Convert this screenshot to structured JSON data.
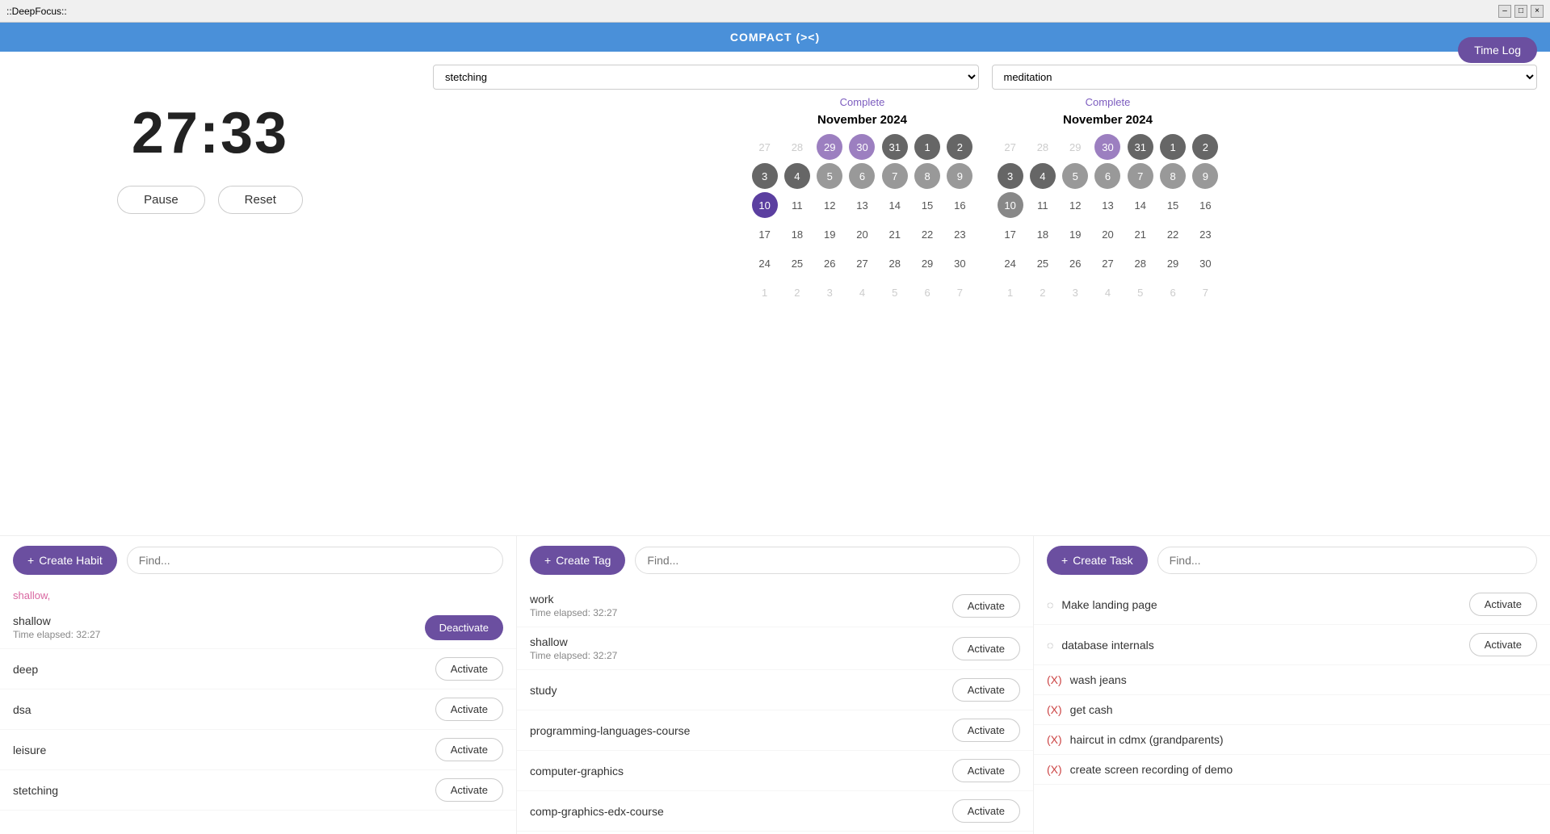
{
  "titleBar": {
    "appName": "::DeepFocus::",
    "controls": [
      "–",
      "□",
      "×"
    ]
  },
  "topBar": {
    "title": "COMPACT (><)"
  },
  "timeLog": {
    "label": "Time Log"
  },
  "timer": {
    "display": "27:33",
    "pauseLabel": "Pause",
    "resetLabel": "Reset"
  },
  "habits": {
    "dropdown1": "stetching",
    "dropdown2": "meditation",
    "completeLabel1": "Complete",
    "completeLabel2": "Complete"
  },
  "calendar1": {
    "title": "November 2024",
    "weeks": [
      [
        "27",
        "28",
        "29",
        "30",
        "31",
        "1",
        "2"
      ],
      [
        "3",
        "4",
        "5",
        "6",
        "7",
        "8",
        "9"
      ],
      [
        "10",
        "11",
        "12",
        "13",
        "14",
        "15",
        "16"
      ],
      [
        "17",
        "18",
        "19",
        "20",
        "21",
        "22",
        "23"
      ],
      [
        "24",
        "25",
        "26",
        "27",
        "28",
        "29",
        "30"
      ],
      [
        "1",
        "2",
        "3",
        "4",
        "5",
        "6",
        "7"
      ]
    ],
    "dayStyles": {
      "27_0": "outer",
      "28_0": "outer",
      "29_0": "filled",
      "30_0": "filled",
      "31_0": "dark",
      "1_0": "dark",
      "2_0": "dark",
      "3_1": "dark",
      "4_1": "dark",
      "5_1": "medium",
      "6_1": "medium",
      "7_1": "medium",
      "8_1": "medium",
      "9_1": "medium",
      "10_2": "today",
      "11_2": "",
      "12_2": "",
      "13_2": "",
      "14_2": "",
      "15_2": "",
      "16_2": "",
      "17_3": "",
      "18_3": "",
      "19_3": "",
      "20_3": "",
      "21_3": "",
      "22_3": "",
      "23_3": "",
      "24_4": "",
      "25_4": "",
      "26_4": "",
      "27_4": "",
      "28_4": "",
      "29_4": "",
      "30_4": "",
      "1_5": "outer",
      "2_5": "outer",
      "3_5": "outer",
      "4_5": "outer",
      "5_5": "outer",
      "6_5": "outer",
      "7_5": "outer"
    }
  },
  "calendar2": {
    "title": "November 2024",
    "weeks": [
      [
        "27",
        "28",
        "29",
        "30",
        "31",
        "1",
        "2"
      ],
      [
        "3",
        "4",
        "5",
        "6",
        "7",
        "8",
        "9"
      ],
      [
        "10",
        "11",
        "12",
        "13",
        "14",
        "15",
        "16"
      ],
      [
        "17",
        "18",
        "19",
        "20",
        "21",
        "22",
        "23"
      ],
      [
        "24",
        "25",
        "26",
        "27",
        "28",
        "29",
        "30"
      ],
      [
        "1",
        "2",
        "3",
        "4",
        "5",
        "6",
        "7"
      ]
    ],
    "dayStyles": {
      "27_0": "outer",
      "28_0": "outer",
      "29_0": "outer",
      "30_0": "filled",
      "31_0": "dark",
      "1_0": "dark",
      "2_0": "dark",
      "3_1": "dark",
      "4_1": "dark",
      "5_1": "medium",
      "6_1": "medium",
      "7_1": "medium",
      "8_1": "medium",
      "9_1": "medium",
      "10_2": "today-gray",
      "11_2": "",
      "12_2": "",
      "13_2": "",
      "14_2": "",
      "15_2": "",
      "16_2": "",
      "17_3": "",
      "18_3": "",
      "19_3": "",
      "20_3": "",
      "21_3": "",
      "22_3": "",
      "23_3": "",
      "24_4": "",
      "25_4": "",
      "26_4": "",
      "27_4": "",
      "28_4": "",
      "29_4": "",
      "30_4": "",
      "1_5": "outer",
      "2_5": "outer",
      "3_5": "outer",
      "4_5": "outer",
      "5_5": "outer",
      "6_5": "outer",
      "7_5": "outer"
    }
  },
  "habitsPanel": {
    "createLabel": "+ Create Habit",
    "findPlaceholder": "Find...",
    "activeTag": "shallow,",
    "items": [
      {
        "name": "shallow",
        "time": "Time elapsed: 32:27",
        "action": "Deactivate",
        "active": true
      },
      {
        "name": "deep",
        "time": null,
        "action": "Activate",
        "active": false
      },
      {
        "name": "dsa",
        "time": null,
        "action": "Activate",
        "active": false
      },
      {
        "name": "leisure",
        "time": null,
        "action": "Activate",
        "active": false
      },
      {
        "name": "stetching",
        "time": null,
        "action": "Activate",
        "active": false
      }
    ]
  },
  "tagsPanel": {
    "createLabel": "+ Create Tag",
    "findPlaceholder": "Find...",
    "items": [
      {
        "name": "work",
        "time": "Time elapsed: 32:27",
        "action": "Activate"
      },
      {
        "name": "shallow",
        "time": "Time elapsed: 32:27",
        "action": "Activate"
      },
      {
        "name": "study",
        "time": null,
        "action": "Activate"
      },
      {
        "name": "programming-languages-course",
        "time": null,
        "action": "Activate"
      },
      {
        "name": "computer-graphics",
        "time": null,
        "action": "Activate"
      },
      {
        "name": "comp-graphics-edx-course",
        "time": null,
        "action": "Activate"
      }
    ]
  },
  "tasksPanel": {
    "createLabel": "+ Create Task",
    "findPlaceholder": "Find...",
    "items": [
      {
        "name": "Make landing page",
        "icon": "spinner",
        "action": "Activate",
        "done": false
      },
      {
        "name": "database internals",
        "icon": "spinner",
        "action": "Activate",
        "done": false
      },
      {
        "name": "wash jeans",
        "icon": "x",
        "action": null,
        "done": true
      },
      {
        "name": "get cash",
        "icon": "x",
        "action": null,
        "done": true
      },
      {
        "name": "haircut in cdmx (grandparents)",
        "icon": "x",
        "action": null,
        "done": true
      },
      {
        "name": "create screen recording of demo",
        "icon": "x",
        "action": null,
        "done": true
      }
    ]
  }
}
